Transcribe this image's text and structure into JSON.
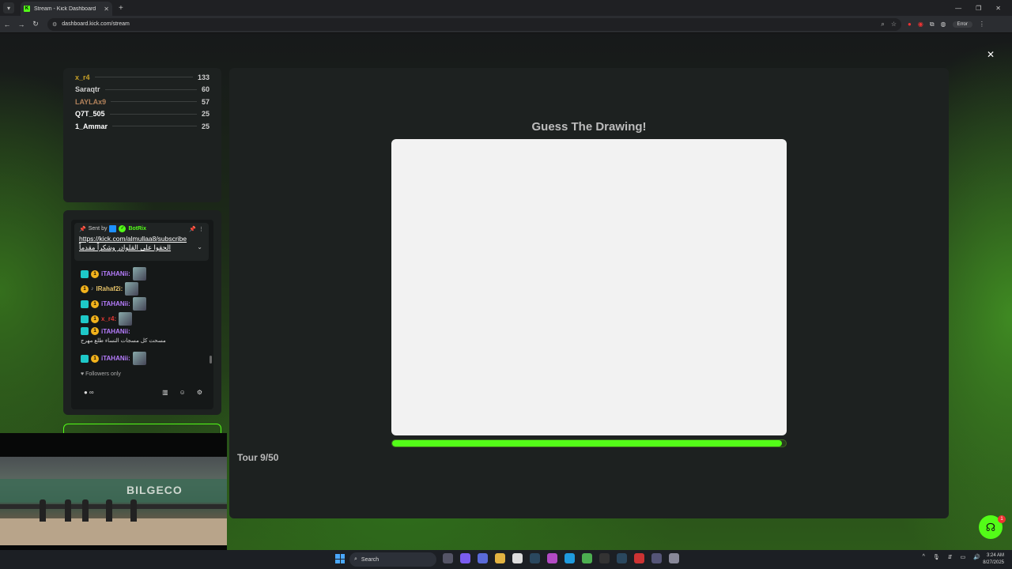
{
  "browser": {
    "tab_title": "Stream - Kick Dashboard",
    "favicon_letter": "K",
    "url": "dashboard.kick.com/stream",
    "error_label": "Error"
  },
  "leaderboard": [
    {
      "name": "x_r4",
      "score": "133",
      "color": "#c9a227"
    },
    {
      "name": "Saraqtr",
      "score": "60",
      "color": "#cfcfcf"
    },
    {
      "name": "LAYLAx9",
      "score": "57",
      "color": "#b0805a"
    },
    {
      "name": "Q7T_505",
      "score": "25",
      "color": "#ffffff"
    },
    {
      "name": "1_Ammar",
      "score": "25",
      "color": "#ffffff"
    }
  ],
  "chat": {
    "pinned": {
      "sent_by": "Sent by",
      "bot_name": "BotRix",
      "link": "https://kick.com/almullaa8/subscribe",
      "arabic": "الحقوا على القلوادر وشكراً مقدماً"
    },
    "messages": [
      {
        "user": "iTAHANii:",
        "color": "#b77dff",
        "text": ""
      },
      {
        "user": "lRahaf2i:",
        "color": "#e6c36a",
        "text": ""
      },
      {
        "user": "iTAHANii:",
        "color": "#b77dff",
        "text": ""
      },
      {
        "user": "x_r4:",
        "color": "#e53935",
        "text": ""
      },
      {
        "user": "iTAHANii:",
        "color": "#b77dff",
        "text": "مسحت كل مسجات النساء طلع مهرج"
      },
      {
        "user": "iTAHANii:",
        "color": "#b77dff",
        "text": ""
      }
    ],
    "followers_only": "Followers only",
    "infinity": "∞"
  },
  "game": {
    "title": "Guess The Drawing!",
    "progress": 0.99,
    "tour": "Tour 9/50"
  },
  "cam": {
    "sign_text": "BILGECO"
  },
  "support_badge": "1",
  "taskbar": {
    "search_label": "Search",
    "time": "3:24 AM",
    "date": "8/27/2025"
  },
  "colors": {
    "accent": "#53fc18"
  }
}
